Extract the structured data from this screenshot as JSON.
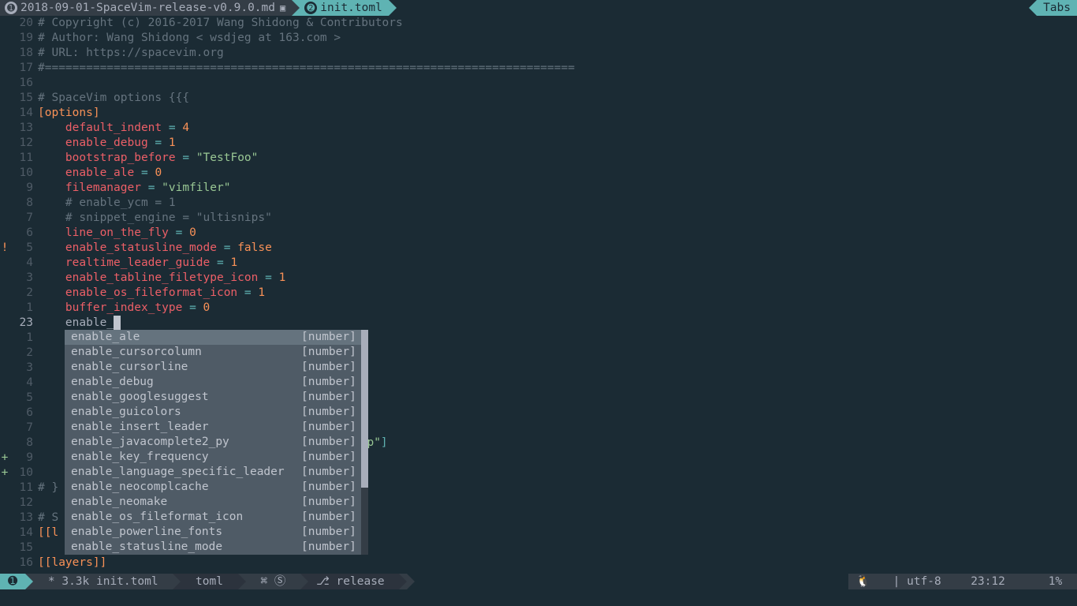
{
  "tabline": {
    "tabs": [
      {
        "num": "➊",
        "label": "2018-09-01-SpaceVim-release-v0.9.0.md",
        "ft_icon": "▾"
      },
      {
        "num": "➋",
        "label": "init.toml",
        "ft_icon": ""
      }
    ],
    "right_label": "Tabs"
  },
  "gutter": {
    "relnums_above": [
      "20",
      "19",
      "18",
      "17",
      "16",
      "15",
      "14",
      "13",
      "12",
      "11",
      "10",
      "9",
      "8",
      "7",
      "6",
      "5",
      "4",
      "3",
      "2",
      "1"
    ],
    "current": "23",
    "relnums_below": [
      "1",
      "2",
      "3",
      "4",
      "5",
      "6",
      "7",
      "8",
      "9",
      "10",
      "11",
      "12",
      "13",
      "14",
      "15",
      "16"
    ],
    "signs": {
      "warn_row": 15,
      "add_rows": [
        28,
        29
      ]
    }
  },
  "code": {
    "l0": "# Copyright (c) 2016-2017 Wang Shidong & Contributors",
    "l1": "# Author: Wang Shidong < wsdjeg at 163.com >",
    "l2": "# URL: https://spacevim.org",
    "l3": "#=============================================================================",
    "l4": "",
    "l5": "# SpaceVim options {{{",
    "sec_open": "[",
    "sec_name": "options",
    "sec_close": "]",
    "k_indent": "default_indent",
    "v_indent": "4",
    "k_debug": "enable_debug",
    "v_debug": "1",
    "k_boots": "bootstrap_before",
    "v_boots": "\"TestFoo\"",
    "k_ale": "enable_ale",
    "v_ale": "0",
    "k_fm": "filemanager",
    "v_fm": "\"vimfiler\"",
    "c_ycm": "# enable_ycm = 1",
    "c_snip": "# snippet_engine = \"ultisnips\"",
    "k_lof": "line_on_the_fly",
    "v_lof": "0",
    "k_esm": "enable_statusline_mode",
    "v_esm": "false",
    "k_rlg": "realtime_leader_guide",
    "v_rlg": "1",
    "k_etfi": "enable_tabline_filetype_icon",
    "v_etfi": "1",
    "k_eofi": "enable_os_fileformat_icon",
    "v_eofi": "1",
    "k_bit": "buffer_index_type",
    "v_bit": "0",
    "cur_prefix": "    enable_",
    "below": {
      "l1_a": "# }",
      "l1_b": "",
      "l3_a": "# S",
      "l4_a": "[[",
      "l4_b": "l",
      "after_popup_8": "'",
      "after_popup_8b": "",
      "after_popup_10": "rep\"",
      "after_popup_10b": "]",
      "l6_a": "[[",
      "l6_b": "layers",
      "l6_c": "]]"
    }
  },
  "completion": {
    "items": [
      {
        "name": "enable_ale",
        "kind": "[number]"
      },
      {
        "name": "enable_cursorcolumn",
        "kind": "[number]"
      },
      {
        "name": "enable_cursorline",
        "kind": "[number]"
      },
      {
        "name": "enable_debug",
        "kind": "[number]"
      },
      {
        "name": "enable_googlesuggest",
        "kind": "[number]"
      },
      {
        "name": "enable_guicolors",
        "kind": "[number]"
      },
      {
        "name": "enable_insert_leader",
        "kind": "[number]"
      },
      {
        "name": "enable_javacomplete2_py",
        "kind": "[number]"
      },
      {
        "name": "enable_key_frequency",
        "kind": "[number]"
      },
      {
        "name": "enable_language_specific_leader",
        "kind": "[number]"
      },
      {
        "name": "enable_neocomplcache",
        "kind": "[number]"
      },
      {
        "name": "enable_neomake",
        "kind": "[number]"
      },
      {
        "name": "enable_os_fileformat_icon",
        "kind": "[number]"
      },
      {
        "name": "enable_powerline_fonts",
        "kind": "[number]"
      },
      {
        "name": "enable_statusline_mode",
        "kind": "[number]"
      }
    ],
    "selected": 0
  },
  "statusline": {
    "mode_icon": "➊",
    "file": " * 3.3k init.toml ",
    "filetype": " toml ",
    "syntax": " ⌘ Ⓢ ",
    "branch": " release ",
    "os_icon": "🐧",
    "encoding": " | utf-8 ",
    "pos": " 23:12 ",
    "percent": "   1% "
  }
}
